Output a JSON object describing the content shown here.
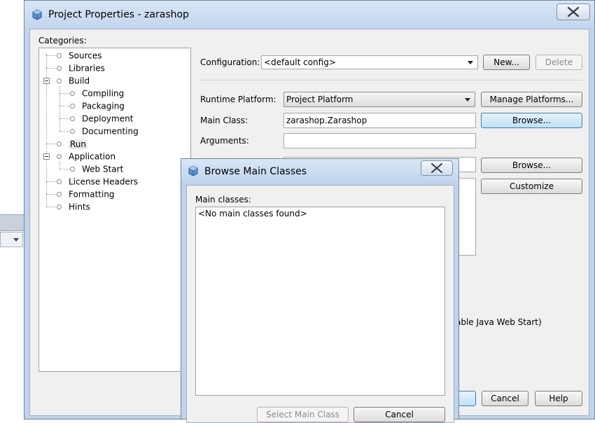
{
  "project_properties": {
    "title": "Project Properties - zarashop",
    "categories_label": "Categories:",
    "tree": [
      {
        "label": "Sources",
        "level": 0
      },
      {
        "label": "Libraries",
        "level": 0
      },
      {
        "label": "Build",
        "level": 0,
        "expanded": true
      },
      {
        "label": "Compiling",
        "level": 1
      },
      {
        "label": "Packaging",
        "level": 1
      },
      {
        "label": "Deployment",
        "level": 1
      },
      {
        "label": "Documenting",
        "level": 1
      },
      {
        "label": "Run",
        "level": 0,
        "selected": true
      },
      {
        "label": "Application",
        "level": 0,
        "expanded": true
      },
      {
        "label": "Web Start",
        "level": 1
      },
      {
        "label": "License Headers",
        "level": 0
      },
      {
        "label": "Formatting",
        "level": 0
      },
      {
        "label": "Hints",
        "level": 0
      }
    ],
    "configuration_label": "Configuration:",
    "configuration_value": "<default config>",
    "new_button": "New...",
    "delete_button": "Delete",
    "runtime_platform_label": "Runtime Platform:",
    "runtime_platform_value": "Project Platform",
    "manage_platforms_button": "Manage Platforms...",
    "main_class_label": "Main Class:",
    "main_class_value": "zarashop.Zarashop",
    "browse_button": "Browse...",
    "arguments_label": "Arguments:",
    "arguments_value": "",
    "browse_button_2": "Browse...",
    "customize_button": "Customize",
    "webstart_note": "able Java Web Start)",
    "cancel_button": "Cancel",
    "help_button": "Help"
  },
  "browse_dialog": {
    "title": "Browse Main Classes",
    "main_classes_label": "Main classes:",
    "empty_text": "<No main classes found>",
    "select_button": "Select Main Class",
    "cancel_button": "Cancel"
  },
  "colors": {
    "titlebar": "#c2d6ee",
    "focus_button": "#bfe0f6",
    "client_bg": "#f0f0f0"
  }
}
